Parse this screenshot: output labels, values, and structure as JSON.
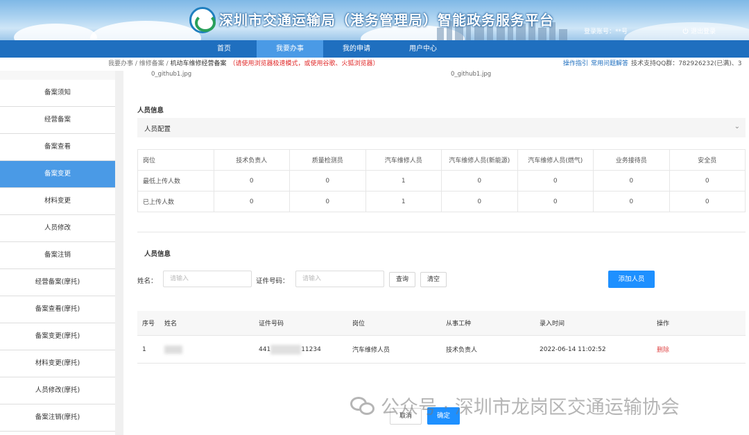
{
  "header": {
    "title": "深圳市交通运输局（港务管理局）智能政务服务平台",
    "account": "登录账号：**号",
    "logout": "退出登录"
  },
  "nav": [
    "首页",
    "我要办事",
    "我的申请",
    "用户中心"
  ],
  "breadcrumb": {
    "path": "我要办事 / 维修备案 / ",
    "current": "机动车维修经营备案",
    "warning": "（请使用浏览器极速模式，或使用谷歌、火狐浏览器）"
  },
  "links": {
    "guide": "操作指引",
    "faq": "常用问题解答",
    "support": "技术支持QQ群：782926232(已满)、3"
  },
  "sidebar": [
    "备案须知",
    "经营备案",
    "备案查看",
    "备案变更",
    "材料变更",
    "人员修改",
    "备案注销",
    "经营备案(摩托)",
    "备案查看(摩托)",
    "备案变更(摩托)",
    "材料变更(摩托)",
    "人员修改(摩托)",
    "备案注销(摩托)"
  ],
  "files": [
    "0_github1.jpg",
    "0_github1.jpg"
  ],
  "personnel": {
    "section_title": "人员信息",
    "config_label": "人员配置",
    "table": {
      "headers": [
        "岗位",
        "技术负责人",
        "质量检测员",
        "汽车维修人员",
        "汽车维修人员(新能源)",
        "汽车维修人员(燃气)",
        "业务接待员",
        "安全员"
      ],
      "rows": [
        [
          "最低上传人数",
          "0",
          "0",
          "1",
          "0",
          "0",
          "0",
          "0"
        ],
        [
          "已上传人数",
          "0",
          "0",
          "1",
          "0",
          "0",
          "0",
          "0"
        ]
      ]
    }
  },
  "search": {
    "section_title": "人员信息",
    "name_label": "姓名：",
    "name_placeholder": "请输入",
    "id_label": "证件号码：",
    "id_placeholder": "请输入",
    "query": "查询",
    "clear": "清空",
    "add": "添加人员"
  },
  "list": {
    "headers": [
      "序号",
      "姓名",
      "证件号码",
      "岗位",
      "从事工种",
      "录入时间",
      "操作"
    ],
    "rows": [
      {
        "index": "1",
        "id_prefix": "441",
        "id_suffix": "11234",
        "post": "汽车维修人员",
        "work": "技术负责人",
        "time": "2022-06-14 11:02:52",
        "action": "删除"
      }
    ]
  },
  "footer": {
    "cancel": "取消",
    "confirm": "确定"
  },
  "watermark": "公众号 · 深圳市龙岗区交通运输协会"
}
